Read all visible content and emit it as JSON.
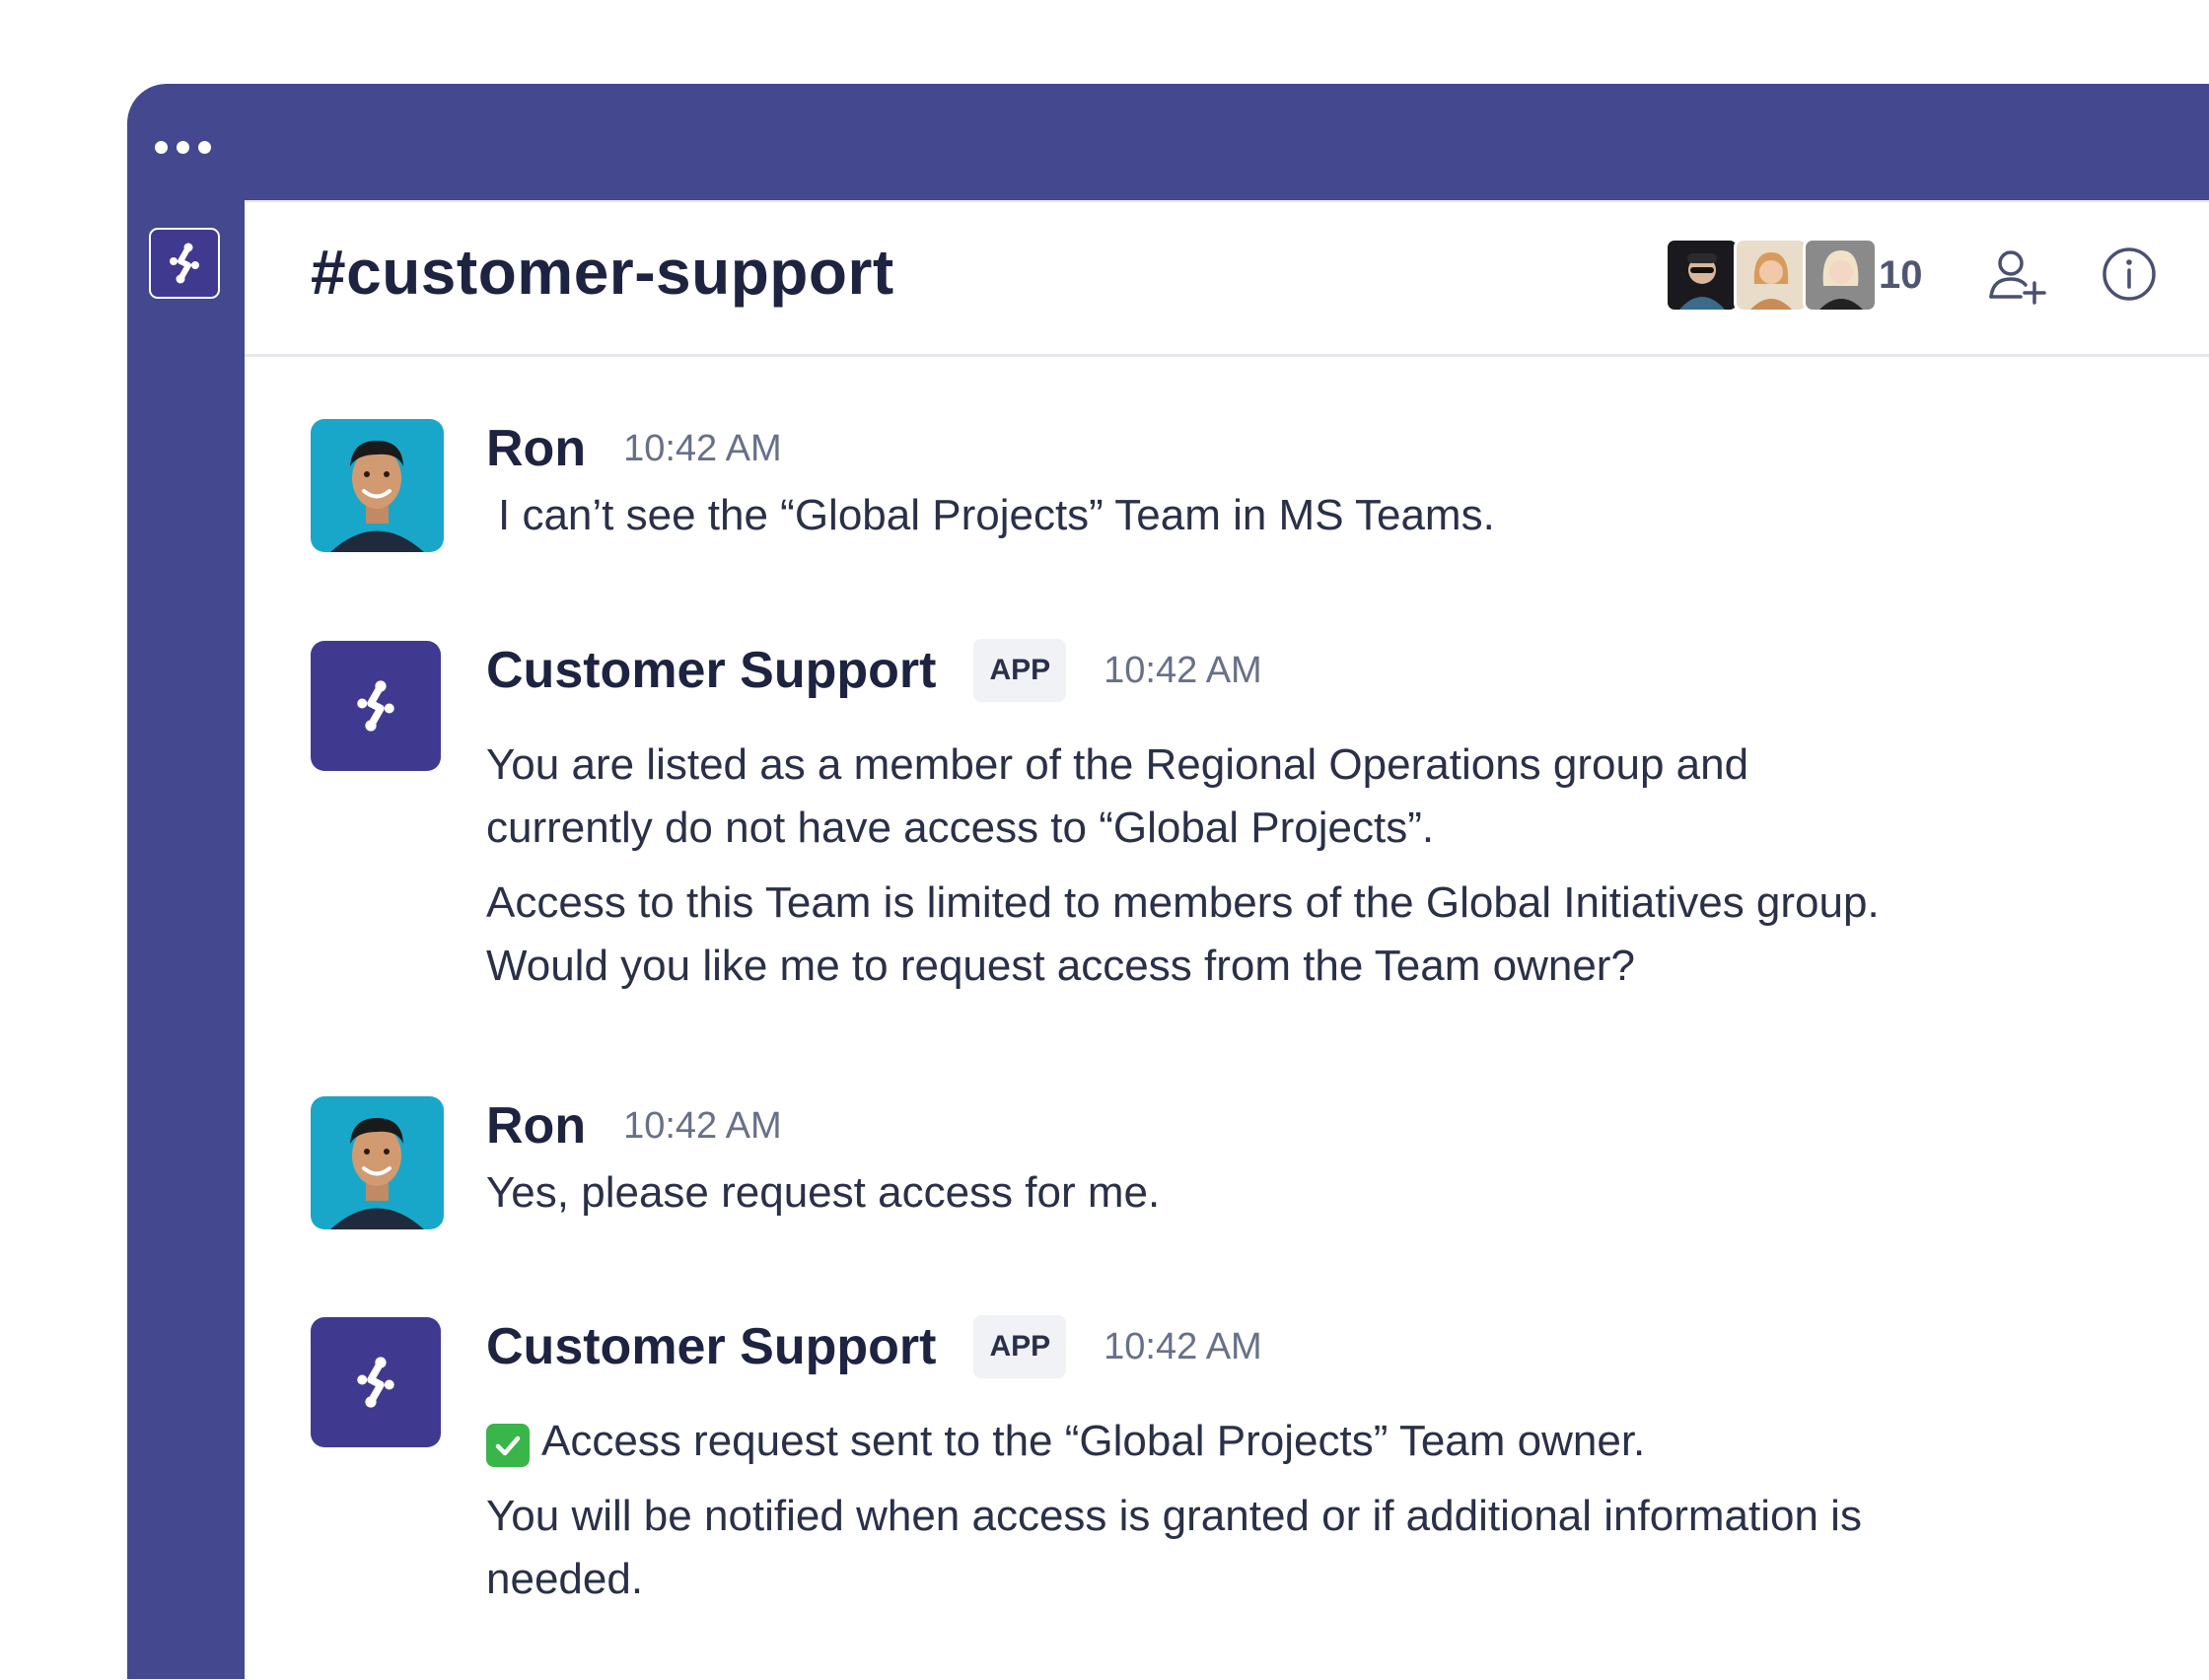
{
  "channel": {
    "title": "#customer-support",
    "member_count": "10"
  },
  "header_icons": {
    "add_member": "add-user-icon",
    "info": "info-icon"
  },
  "colors": {
    "brand": "#44488e",
    "app_avatar": "#3f3a8f",
    "check": "#39b54a"
  },
  "messages": [
    {
      "sender": "Ron",
      "time": "10:42 AM",
      "lines": [
        "I can’t see the “Global Projects” Team in MS Teams."
      ]
    },
    {
      "sender": "Customer Support",
      "badge": "APP",
      "time": "10:42 AM",
      "lines": [
        "You are listed as a member of the Regional Operations group and",
        "currently do not have access to “Global Projects”.",
        "Access to this Team is limited to members of the Global Initiatives group.",
        "Would you like me to request access from the Team owner?"
      ]
    },
    {
      "sender": "Ron",
      "time": "10:42 AM",
      "lines": [
        "Yes, please request access for me."
      ]
    },
    {
      "sender": "Customer Support",
      "badge": "APP",
      "time": "10:42 AM",
      "lines": [
        "Access request sent to the “Global Projects” Team owner.",
        "You will be notified when access is granted or if additional information is",
        "needed."
      ]
    }
  ]
}
